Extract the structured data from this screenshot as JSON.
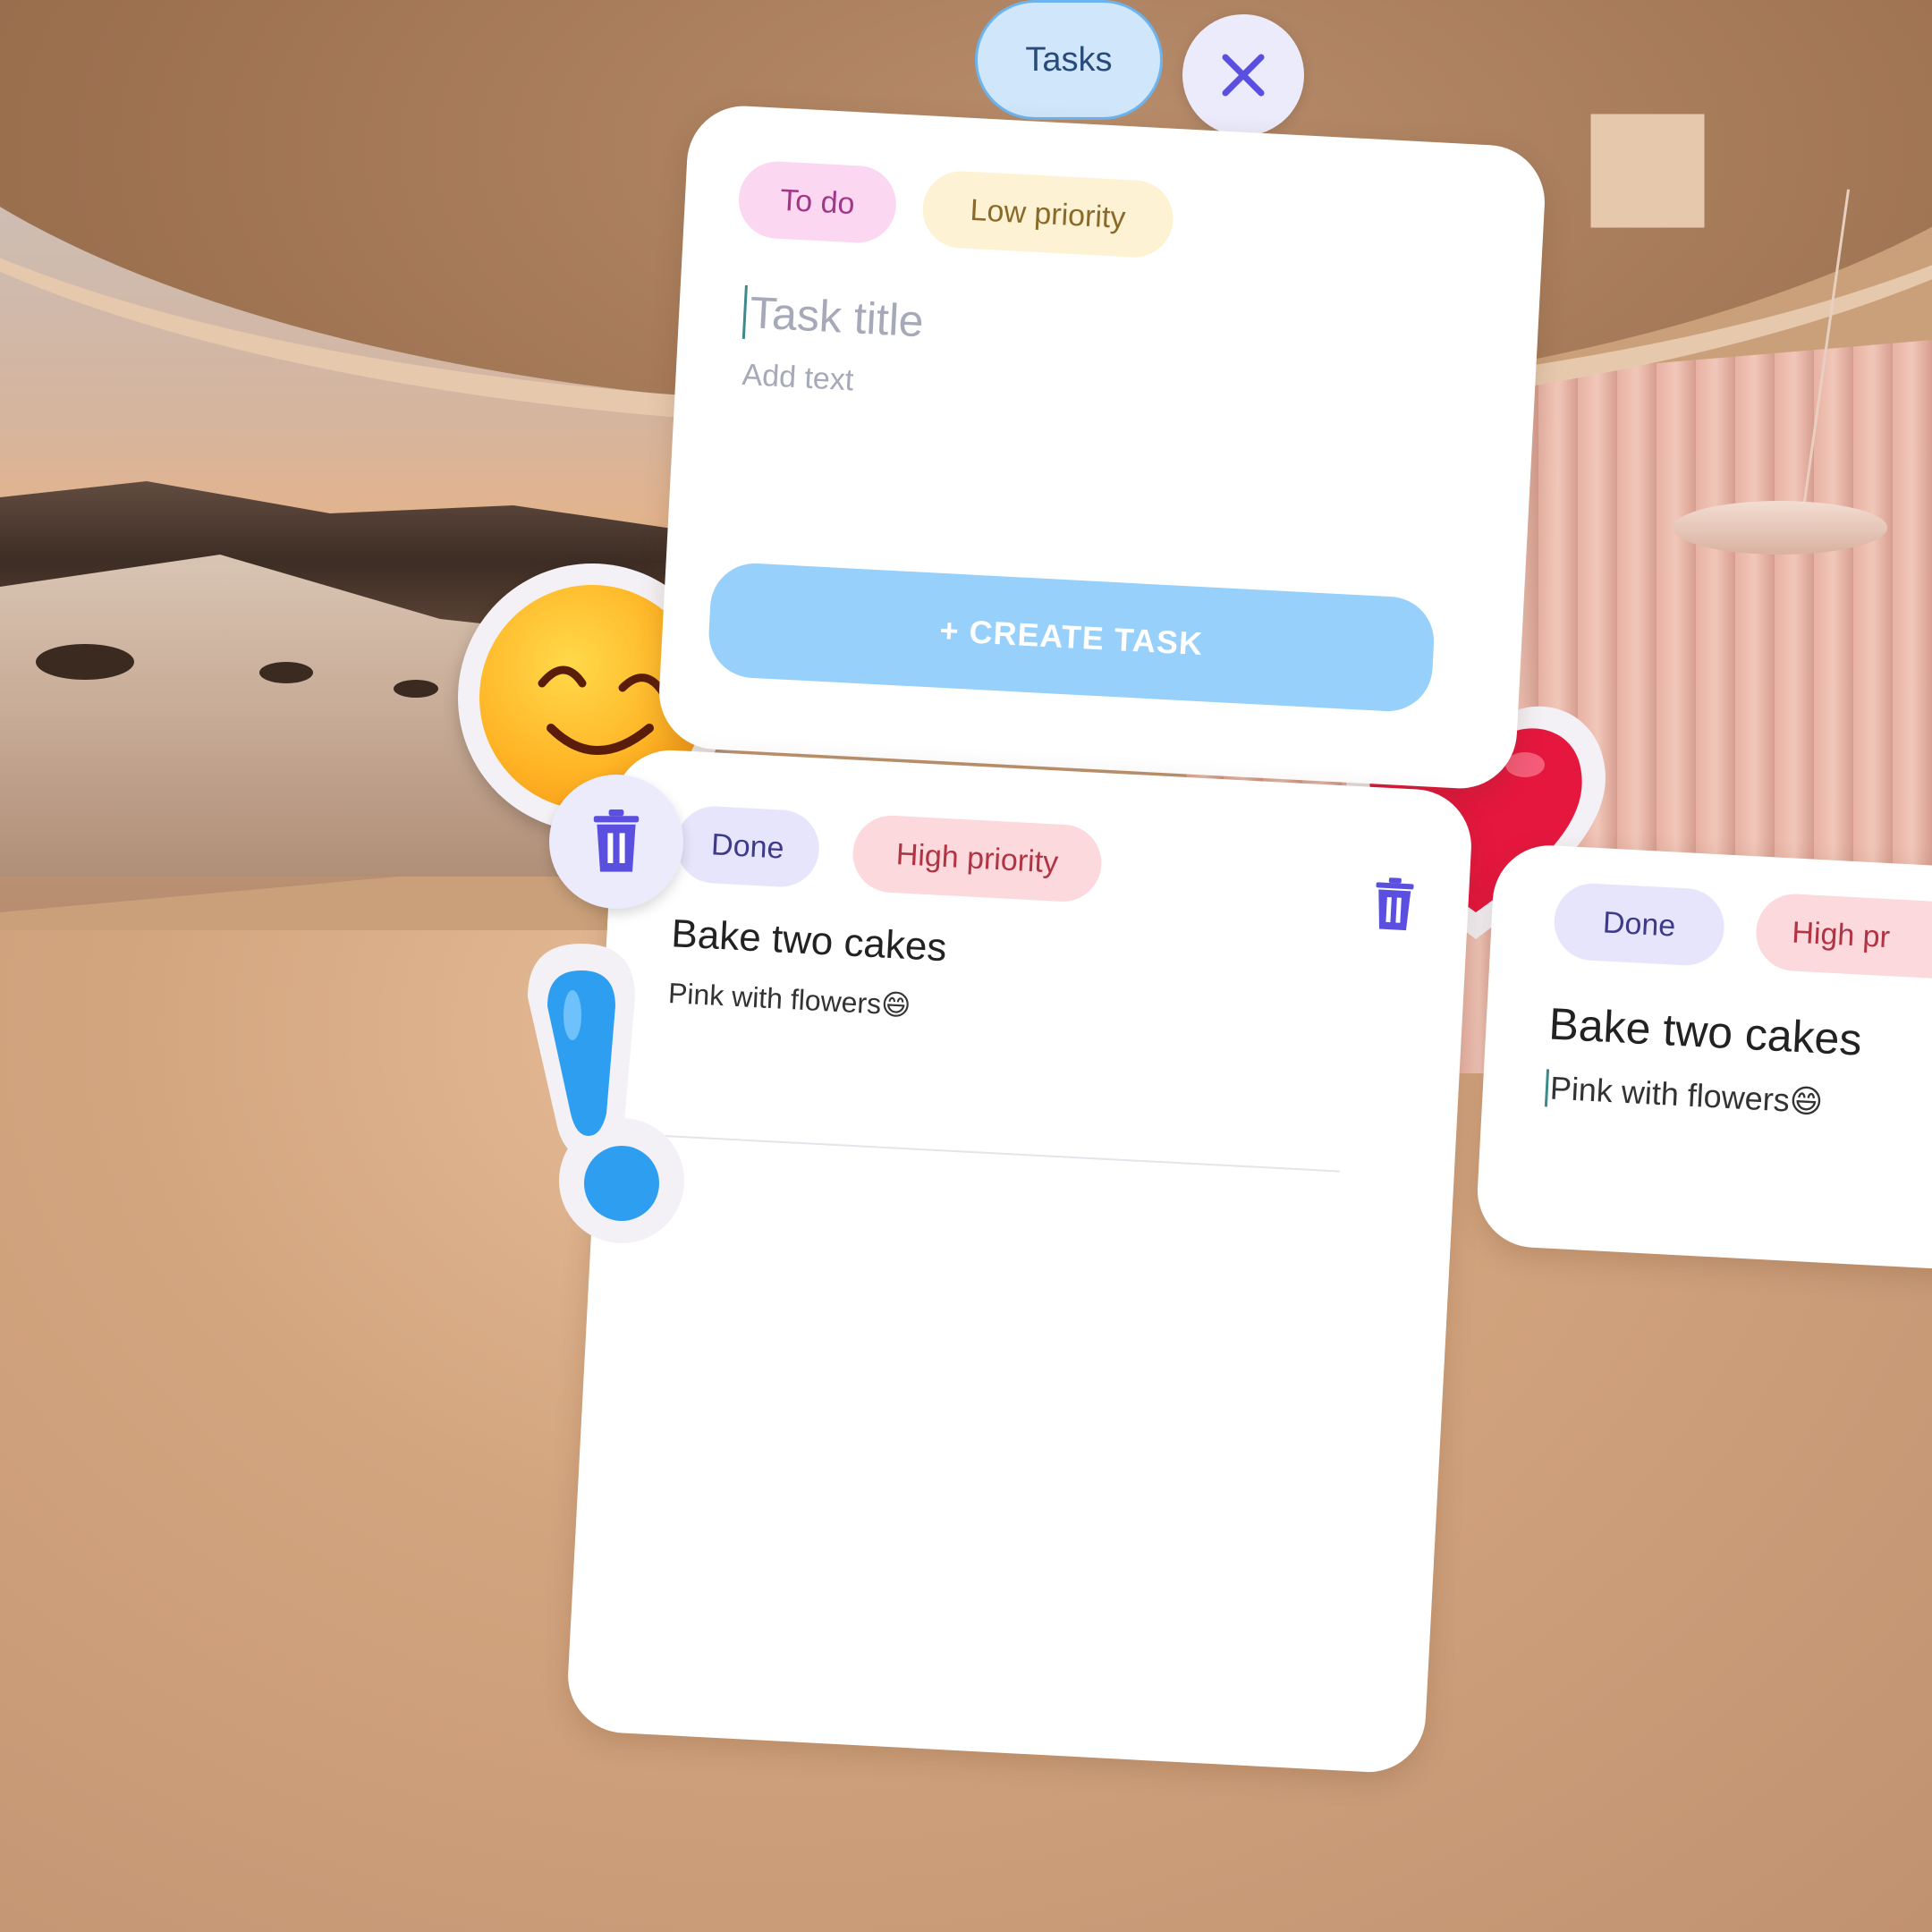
{
  "header": {
    "tab_label": "Tasks",
    "close_icon": "close-icon"
  },
  "new_task": {
    "status_chip": "To do",
    "priority_chip": "Low priority",
    "title_placeholder": "Task title",
    "body_placeholder": "Add text",
    "create_button": "+ CREATE TASK"
  },
  "tasks": [
    {
      "status": "Done",
      "priority": "High priority",
      "title": "Bake two cakes",
      "description": "Pink with flowers😄"
    },
    {
      "status": "Done",
      "priority": "High pr",
      "title": "Bake two cakes",
      "description": "Pink with flowers😄"
    }
  ],
  "stickers": [
    "smiley-sticker",
    "heart-sticker",
    "exclamation-sticker"
  ],
  "colors": {
    "accent": "#5b4fe0",
    "create_button": "#96d0fb",
    "tab_bg": "#cfe6fb"
  }
}
